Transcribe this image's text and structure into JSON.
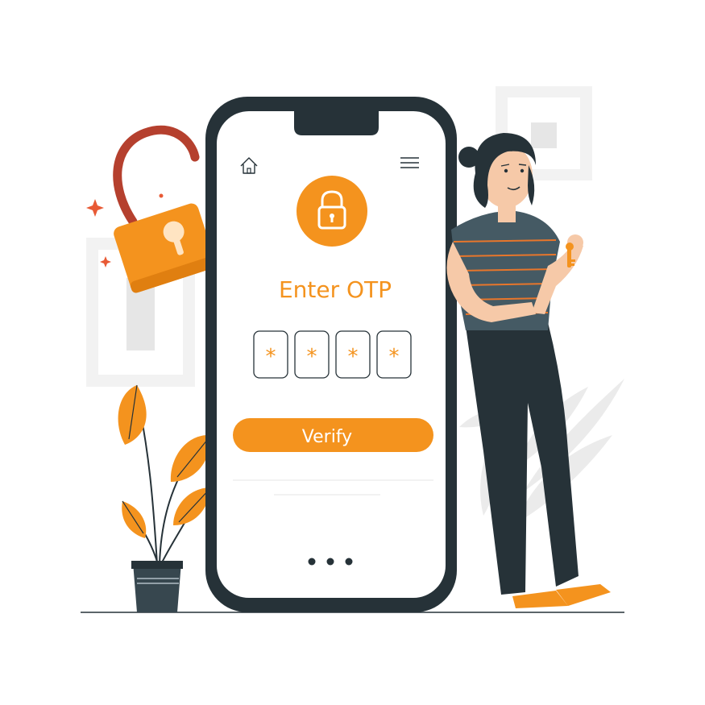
{
  "screen": {
    "title": "Enter OTP",
    "otp_digits": [
      "*",
      "*",
      "*",
      "*"
    ],
    "verify_label": "Verify",
    "home_icon": "home-icon",
    "menu_icon": "hamburger-menu-icon",
    "lock_icon": "padlock-icon",
    "pager_icon": "more-dots-icon"
  },
  "colors": {
    "accent": "#F4931E",
    "dark": "#263238",
    "red": "#C0392B",
    "light_gray": "#EBEBEB",
    "screen_bg": "#FFFFFF"
  }
}
